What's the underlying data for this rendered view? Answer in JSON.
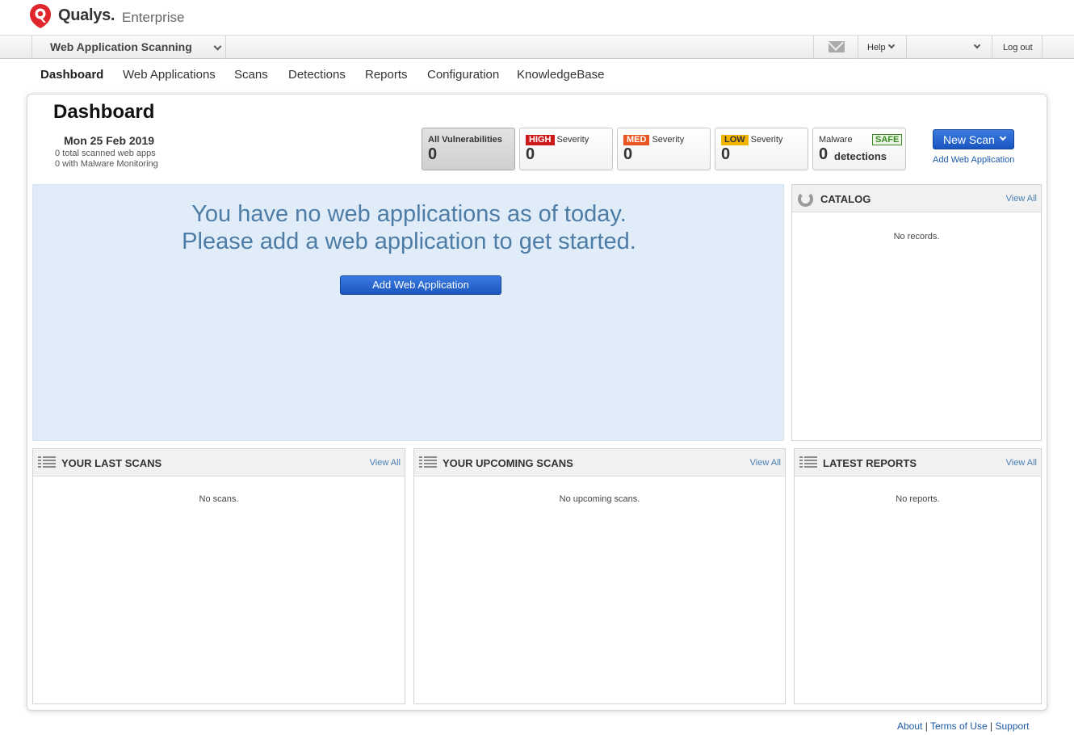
{
  "brand": {
    "name": "Qualys.",
    "edition": "Enterprise"
  },
  "topbar": {
    "module": "Web Application Scanning",
    "help": "Help",
    "user": "",
    "logout": "Log out"
  },
  "nav": {
    "items": [
      "Dashboard",
      "Web Applications",
      "Scans",
      "Detections",
      "Reports",
      "Configuration",
      "KnowledgeBase"
    ],
    "active": "Dashboard"
  },
  "dashboard": {
    "title": "Dashboard",
    "date": "Mon 25 Feb 2019",
    "scanned_apps": "0 total scanned web apps",
    "malware_monitoring": "0 with Malware Monitoring"
  },
  "severity": {
    "all": {
      "label": "All Vulnerabilities",
      "value": "0"
    },
    "high": {
      "badge": "HIGH",
      "label": "Severity",
      "value": "0",
      "color": "#cc1a1a"
    },
    "med": {
      "badge": "MED",
      "label": "Severity",
      "value": "0",
      "color": "#e8561f"
    },
    "low": {
      "badge": "LOW",
      "label": "Severity",
      "value": "0",
      "color": "#f2b400"
    },
    "malware": {
      "label": "Malware",
      "badge": "SAFE",
      "value": "0",
      "detections": "detections"
    }
  },
  "actions": {
    "new_scan": "New Scan",
    "add_web_application": "Add Web Application"
  },
  "empty_state": {
    "line1": "You have no web applications as of today.",
    "line2": "Please add a web application to get started.",
    "button": "Add Web Application"
  },
  "widgets": {
    "catalog": {
      "title": "CATALOG",
      "view_all": "View All",
      "empty": "No records."
    },
    "last_scans": {
      "title": "YOUR LAST SCANS",
      "view_all": "View All",
      "empty": "No scans."
    },
    "upcoming_scans": {
      "title": "YOUR UPCOMING SCANS",
      "view_all": "View All",
      "empty": "No upcoming scans."
    },
    "latest_reports": {
      "title": "LATEST REPORTS",
      "view_all": "View All",
      "empty": "No reports."
    }
  },
  "footer": {
    "about": "About",
    "terms": "Terms of Use",
    "support": "Support",
    "separator": "|"
  },
  "colors": {
    "accent_blue": "#1a56c0",
    "empty_bg": "#e0edf8",
    "empty_text": "#4d7ca6",
    "brand_red": "#e0252d"
  }
}
